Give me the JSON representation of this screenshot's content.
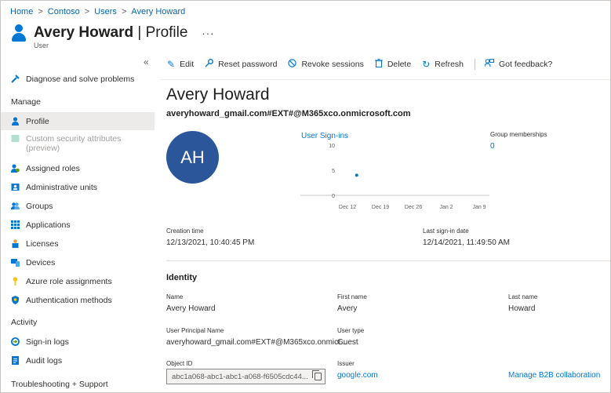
{
  "breadcrumb": {
    "home": "Home",
    "tenant": "Contoso",
    "users": "Users",
    "current": "Avery Howard",
    "sep": ">"
  },
  "header": {
    "name": "Avery Howard",
    "divider": " | ",
    "page": "Profile",
    "more": "···",
    "subtitle": "User"
  },
  "sidebar": {
    "collapse": "«",
    "diagnose": "Diagnose and solve problems",
    "manage_header": "Manage",
    "items": [
      {
        "label": "Profile",
        "icon": "user-icon"
      },
      {
        "label": "Custom security attributes",
        "label2": "(preview)",
        "icon": "tag-icon"
      },
      {
        "label": "Assigned roles",
        "icon": "role-icon"
      },
      {
        "label": "Administrative units",
        "icon": "admin-unit-icon"
      },
      {
        "label": "Groups",
        "icon": "groups-icon"
      },
      {
        "label": "Applications",
        "icon": "apps-icon"
      },
      {
        "label": "Licenses",
        "icon": "license-icon"
      },
      {
        "label": "Devices",
        "icon": "device-icon"
      },
      {
        "label": "Azure role assignments",
        "icon": "key-icon"
      },
      {
        "label": "Authentication methods",
        "icon": "shield-icon"
      }
    ],
    "activity_header": "Activity",
    "activity_items": [
      {
        "label": "Sign-in logs",
        "icon": "signin-icon"
      },
      {
        "label": "Audit logs",
        "icon": "audit-icon"
      }
    ],
    "troubleshooting_header": "Troubleshooting + Support"
  },
  "toolbar": {
    "edit": "Edit",
    "reset_password": "Reset password",
    "revoke_sessions": "Revoke sessions",
    "delete": "Delete",
    "refresh": "Refresh",
    "feedback": "Got feedback?"
  },
  "profile": {
    "display_name": "Avery Howard",
    "upn": "averyhoward_gmail.com#EXT#@M365xco.onmicrosoft.com",
    "initials": "AH",
    "signins_title": "User Sign-ins",
    "group_memberships_label": "Group memberships",
    "group_memberships_value": "0",
    "creation_time_label": "Creation time",
    "creation_time_value": "12/13/2021, 10:40:45 PM",
    "last_signin_label": "Last sign-in date",
    "last_signin_value": "12/14/2021, 11:49:50 AM"
  },
  "identity": {
    "header": "Identity",
    "name_label": "Name",
    "name_value": "Avery Howard",
    "first_name_label": "First name",
    "first_name_value": "Avery",
    "last_name_label": "Last name",
    "last_name_value": "Howard",
    "upn_label": "User Principal Name",
    "upn_value": "averyhoward_gmail.com#EXT#@M365xco.onmicr...",
    "user_type_label": "User type",
    "user_type_value": "Guest",
    "object_id_label": "Object ID",
    "object_id_value": "abc1a068-abc1-abc1-a068-f6505cdc44...",
    "issuer_label": "Issuer",
    "issuer_value": "google.com",
    "manage_b2b": "Manage B2B collaboration"
  },
  "chart_data": {
    "type": "scatter",
    "title": "User Sign-ins",
    "x_categories": [
      "Dec 12",
      "Dec 19",
      "Dec 26",
      "Jan 2",
      "Jan 9"
    ],
    "y_ticks": [
      0,
      5,
      10
    ],
    "ylim": [
      0,
      10
    ],
    "points": [
      {
        "x": "Dec 14",
        "x_index": 0.28,
        "y": 4
      }
    ],
    "colors": {
      "point": "#0078d4"
    }
  }
}
